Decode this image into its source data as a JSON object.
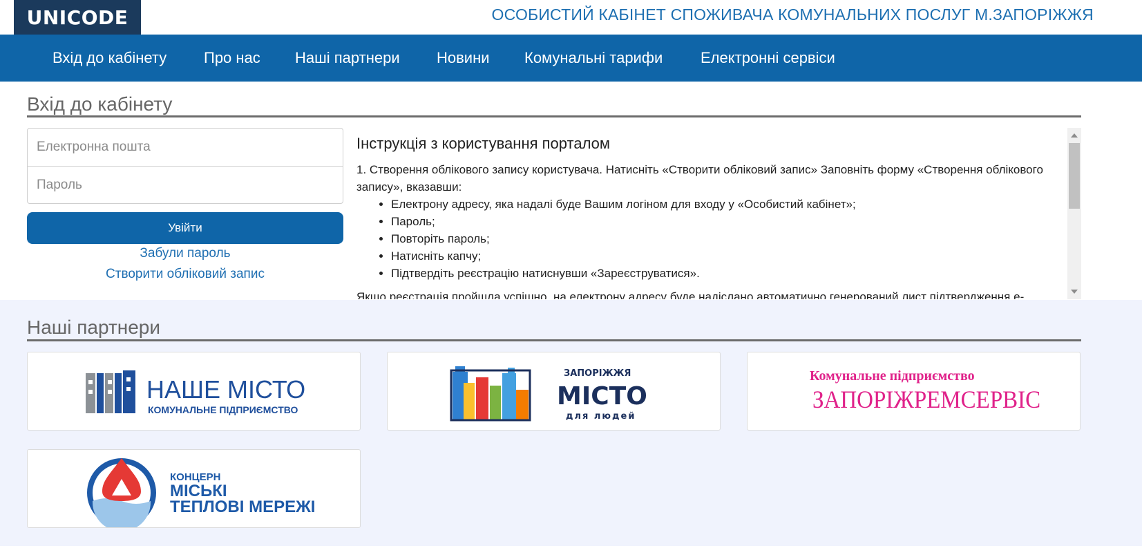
{
  "header": {
    "logo_text": "UNICODE",
    "site_title": "ОСОБИСТИЙ КАБІНЕТ СПОЖИВАЧА КОМУНАЛЬНИХ ПОСЛУГ М.ЗАПОРІЖЖЯ"
  },
  "nav": {
    "items": [
      {
        "label": "Вхід до кабінету"
      },
      {
        "label": "Про нас"
      },
      {
        "label": "Наші партнери"
      },
      {
        "label": "Новини"
      },
      {
        "label": "Комунальні тарифи"
      },
      {
        "label": "Електронні сервіси"
      }
    ]
  },
  "login": {
    "section_title": "Вхід до кабінету",
    "email_placeholder": "Електронна пошта",
    "password_placeholder": "Пароль",
    "submit_label": "Увійти",
    "forgot_link": "Забули пароль",
    "register_link": "Створити обліковий запис"
  },
  "instructions": {
    "title": "Інструкція з користування порталом",
    "step1": "1. Створення облікового запису користувача. Натисніть «Створити обліковий запис» Заповніть форму «Створення облікового запису», вказавши:",
    "bullets": [
      "Електрону адресу, яка надалі буде Вашим логіном для входу у «Особистий кабінет»;",
      "Пароль;",
      "Повторіть пароль;",
      "Натисніть капчу;",
      "Підтвердіть реєстрацію натиснувши «Зареєструватися»."
    ],
    "after_text": "Якщо реєстрація пройшла успішно, на електрону адресу буде надіслано автоматично генерований лист підтвердження е-"
  },
  "partners": {
    "section_title": "Наші партнери",
    "cards": [
      {
        "line1": "НАШЕ МІСТО",
        "line2": "КОМУНАЛЬНЕ ПІДПРИЄМСТВО"
      },
      {
        "line1": "ЗАПОРІЖЖЯ",
        "line2": "МІСТО",
        "line3": "для людей"
      },
      {
        "line1": "Комунальне підприємство",
        "line2": "ЗАПОРІЖРЕМСЕРВІС"
      },
      {
        "line1": "КОНЦЕРН",
        "line2": "МІСЬКІ",
        "line3": "ТЕПЛОВІ МЕРЕЖІ"
      }
    ]
  },
  "colors": {
    "nav_bg": "#0f65a8",
    "logo_bg": "#1b3a5c",
    "title_blue": "#1d6fb1",
    "partners_bg": "#f0f3fd",
    "magenta": "#e0228a"
  }
}
